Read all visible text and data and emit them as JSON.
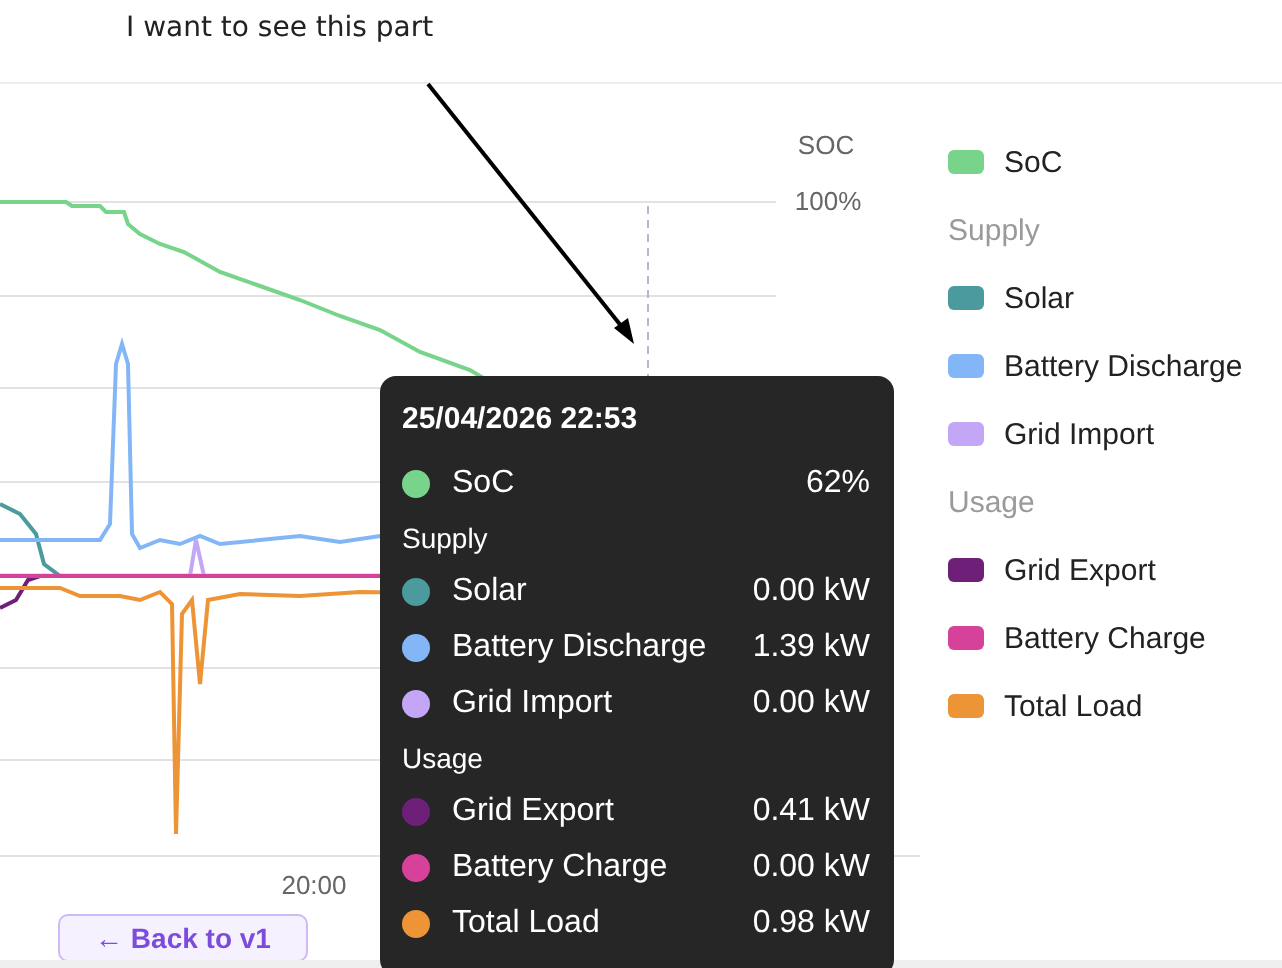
{
  "annotation": {
    "text": "I want to see this part"
  },
  "chart": {
    "axis_title": "SOC",
    "y_labels": [
      "100%"
    ],
    "x_labels": [
      "20:00"
    ]
  },
  "legend": [
    {
      "kind": "series",
      "label": "SoC",
      "color": "#77d48a"
    },
    {
      "kind": "group",
      "label": "Supply"
    },
    {
      "kind": "series",
      "label": "Solar",
      "color": "#4a9a9e"
    },
    {
      "kind": "series",
      "label": "Battery Discharge",
      "color": "#82b6f7"
    },
    {
      "kind": "series",
      "label": "Grid Import",
      "color": "#c3a6f5"
    },
    {
      "kind": "group",
      "label": "Usage"
    },
    {
      "kind": "series",
      "label": "Grid Export",
      "color": "#6e1f78"
    },
    {
      "kind": "series",
      "label": "Battery Charge",
      "color": "#d6419a"
    },
    {
      "kind": "series",
      "label": "Total Load",
      "color": "#ec9436"
    }
  ],
  "tooltip": {
    "title": "25/04/2026 22:53",
    "rows": [
      {
        "kind": "series",
        "label": "SoC",
        "value": "62%",
        "color": "#77d48a"
      },
      {
        "kind": "group",
        "label": "Supply"
      },
      {
        "kind": "series",
        "label": "Solar",
        "value": "0.00 kW",
        "color": "#4a9a9e"
      },
      {
        "kind": "series",
        "label": "Battery Discharge",
        "value": "1.39 kW",
        "color": "#82b6f7"
      },
      {
        "kind": "series",
        "label": "Grid Import",
        "value": "0.00 kW",
        "color": "#c3a6f5"
      },
      {
        "kind": "group",
        "label": "Usage"
      },
      {
        "kind": "series",
        "label": "Grid Export",
        "value": "0.41 kW",
        "color": "#6e1f78"
      },
      {
        "kind": "series",
        "label": "Battery Charge",
        "value": "0.00 kW",
        "color": "#d6419a"
      },
      {
        "kind": "series",
        "label": "Total Load",
        "value": "0.98 kW",
        "color": "#ec9436"
      }
    ]
  },
  "back_button": {
    "label": "← Back to v1"
  }
}
